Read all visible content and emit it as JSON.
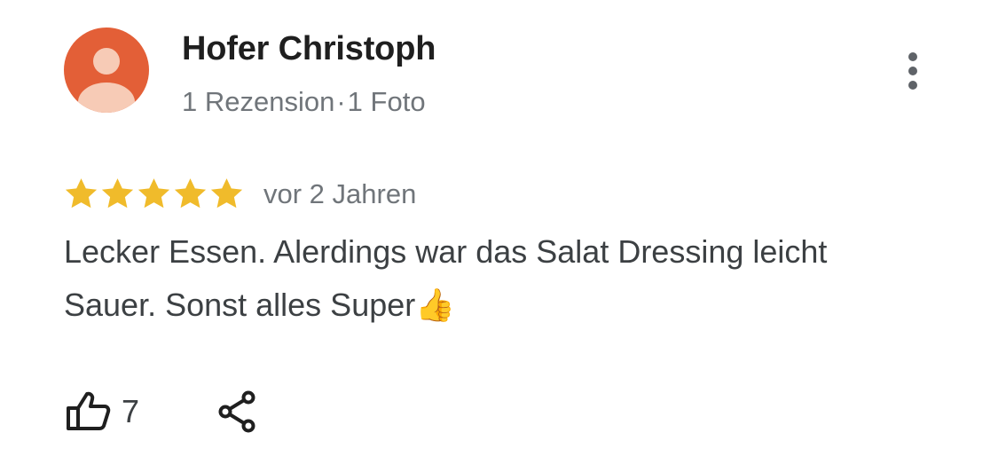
{
  "author": {
    "name": "Hofer Christoph",
    "reviews_count": "1 Rezension",
    "separator": "·",
    "photos_count": "1 Foto",
    "avatar_color": "#e35f37"
  },
  "review": {
    "rating": 5,
    "max_rating": 5,
    "star_color": "#f0bb2b",
    "date": "vor 2 Jahren",
    "text": "Lecker Essen. Alerdings war das Salat Dressing leicht Sauer. Sonst alles Super👍"
  },
  "actions": {
    "like_icon": "thumbs-up-outline-icon",
    "like_count": "7",
    "share_icon": "share-icon",
    "more_icon": "more-vertical-icon"
  },
  "colors": {
    "text_primary": "#1f1f1f",
    "text_secondary": "#70757a",
    "text_body": "#3c4043"
  }
}
